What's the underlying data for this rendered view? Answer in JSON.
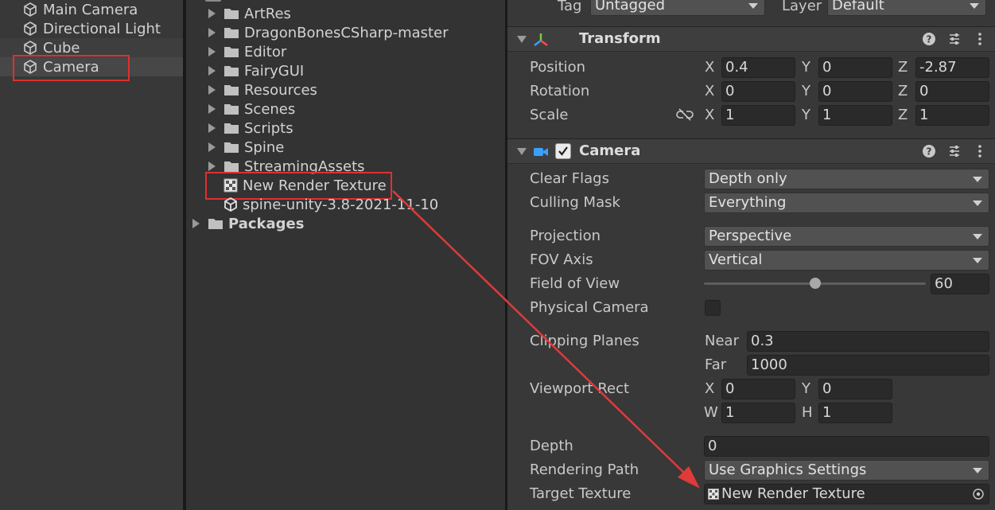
{
  "hierarchy": {
    "items": [
      {
        "label": "Main Camera"
      },
      {
        "label": "Directional Light"
      },
      {
        "label": "Cube"
      },
      {
        "label": "Camera"
      }
    ]
  },
  "project": {
    "folders": [
      {
        "label": "ArtRes"
      },
      {
        "label": "DragonBonesCSharp-master"
      },
      {
        "label": "Editor"
      },
      {
        "label": "FairyGUI"
      },
      {
        "label": "Resources"
      },
      {
        "label": "Scenes"
      },
      {
        "label": "Scripts"
      },
      {
        "label": "Spine"
      },
      {
        "label": "StreamingAssets"
      }
    ],
    "render_texture": "New Render Texture",
    "package_asset": "spine-unity-3.8-2021-11-10",
    "packages": "Packages"
  },
  "inspector": {
    "tag_label": "Tag",
    "tag_value": "Untagged",
    "layer_label": "Layer",
    "layer_value": "Default",
    "transform": {
      "title": "Transform",
      "position_label": "Position",
      "rotation_label": "Rotation",
      "scale_label": "Scale",
      "axis_x": "X",
      "axis_y": "Y",
      "axis_z": "Z",
      "position": {
        "x": "0.4",
        "y": "0",
        "z": "-2.87"
      },
      "rotation": {
        "x": "0",
        "y": "0",
        "z": "0"
      },
      "scale": {
        "x": "1",
        "y": "1",
        "z": "1"
      }
    },
    "camera": {
      "title": "Camera",
      "clear_flags_label": "Clear Flags",
      "clear_flags_value": "Depth only",
      "culling_mask_label": "Culling Mask",
      "culling_mask_value": "Everything",
      "projection_label": "Projection",
      "projection_value": "Perspective",
      "fov_axis_label": "FOV Axis",
      "fov_axis_value": "Vertical",
      "fov_label": "Field of View",
      "fov_value": "60",
      "fov_slider_fraction": 0.5,
      "physical_camera_label": "Physical Camera",
      "clipping_label": "Clipping Planes",
      "near_label": "Near",
      "near_value": "0.3",
      "far_label": "Far",
      "far_value": "1000",
      "viewport_label": "Viewport Rect",
      "vp_x_label": "X",
      "vp_y_label": "Y",
      "vp_w_label": "W",
      "vp_h_label": "H",
      "vp_x": "0",
      "vp_y": "0",
      "vp_w": "1",
      "vp_h": "1",
      "depth_label": "Depth",
      "depth_value": "0",
      "rendering_path_label": "Rendering Path",
      "rendering_path_value": "Use Graphics Settings",
      "target_texture_label": "Target Texture",
      "target_texture_value": "New Render Texture"
    }
  },
  "colors": {
    "highlight_box": "#e03030",
    "arrow": "#e03a3a"
  }
}
